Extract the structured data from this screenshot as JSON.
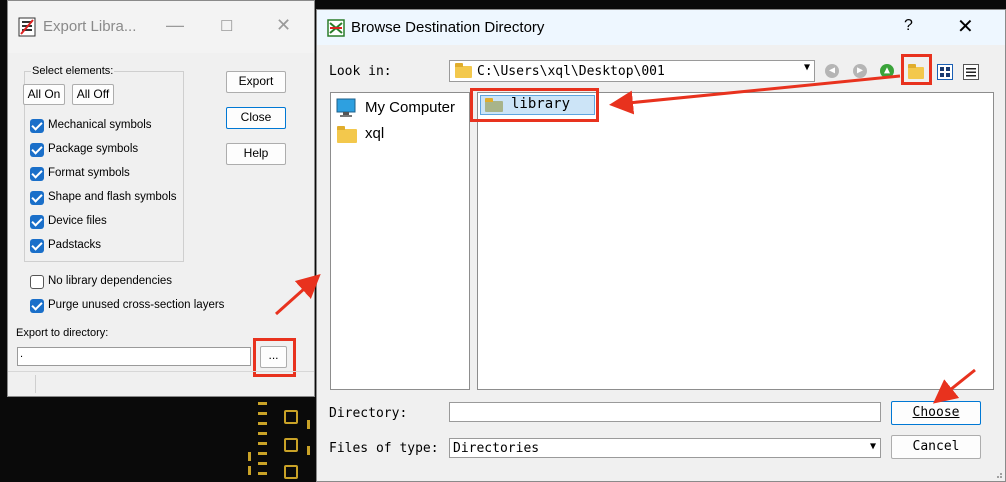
{
  "export_dialog": {
    "title": "Export Libra...",
    "select_label": "Select elements:",
    "all_on": "All On",
    "all_off": "All Off",
    "export_btn": "Export",
    "close_btn": "Close",
    "help_btn": "Help",
    "elements": [
      {
        "label": "Mechanical symbols",
        "checked": true
      },
      {
        "label": "Package symbols",
        "checked": true
      },
      {
        "label": "Format symbols",
        "checked": true
      },
      {
        "label": "Shape and flash symbols",
        "checked": true
      },
      {
        "label": "Device files",
        "checked": true
      },
      {
        "label": "Padstacks",
        "checked": true
      }
    ],
    "no_lib_deps": {
      "label": "No library dependencies",
      "checked": false
    },
    "purge": {
      "label": "Purge unused cross-section layers",
      "checked": true
    },
    "export_dir_label": "Export to directory:",
    "export_dir_value": ".",
    "browse_btn": "..."
  },
  "browse_dialog": {
    "title": "Browse Destination Directory",
    "help": "?",
    "close": "✕",
    "look_in_label": "Look in:",
    "look_in_value": "C:\\Users\\xql\\Desktop\\001",
    "places": [
      {
        "label": "My Computer",
        "icon": "computer-icon"
      },
      {
        "label": "xql",
        "icon": "folder-icon"
      }
    ],
    "files": [
      {
        "label": "library",
        "selected": true
      }
    ],
    "directory_label": "Directory:",
    "directory_value": "",
    "choose_btn": "Choose",
    "files_of_type_label": "Files of type:",
    "files_of_type_value": "Directories",
    "cancel_btn": "Cancel"
  },
  "colors": {
    "highlight": "#e8321e",
    "accent": "#1a6fc9"
  }
}
